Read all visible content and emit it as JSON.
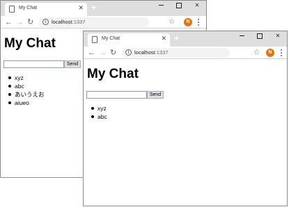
{
  "colors": {
    "titlebar": "#dedede",
    "avatar": "#e8710a",
    "input_border": "#7a9fd4"
  },
  "icons": {
    "tab_page": "document-icon",
    "new_tab": "plus-icon",
    "back": "arrow-left-icon",
    "forward": "arrow-right-icon",
    "reload": "reload-icon",
    "site_info": "info-icon",
    "bookmark": "star-icon",
    "menu": "kebab-menu-icon"
  },
  "glyphs": {
    "tab_close": "✕",
    "new_tab": "+",
    "back": "←",
    "forward": "→",
    "reload": "↻",
    "info": "i",
    "star": "☆"
  },
  "back_window": {
    "tab_title": "My Chat",
    "url_host": "localhost",
    "url_port": ":1337",
    "avatar_letter": "N",
    "page": {
      "heading": "My Chat",
      "input_value": "",
      "send_label": "Send",
      "messages": [
        "xyz",
        "abc",
        "あいうえお",
        "aiueo"
      ]
    }
  },
  "front_window": {
    "tab_title": "My Chat",
    "url_host": "localhost",
    "url_port": ":1337",
    "avatar_letter": "N",
    "page": {
      "heading": "My Chat",
      "input_value": "",
      "send_label": "Send",
      "messages": [
        "xyz",
        "abc"
      ]
    }
  }
}
